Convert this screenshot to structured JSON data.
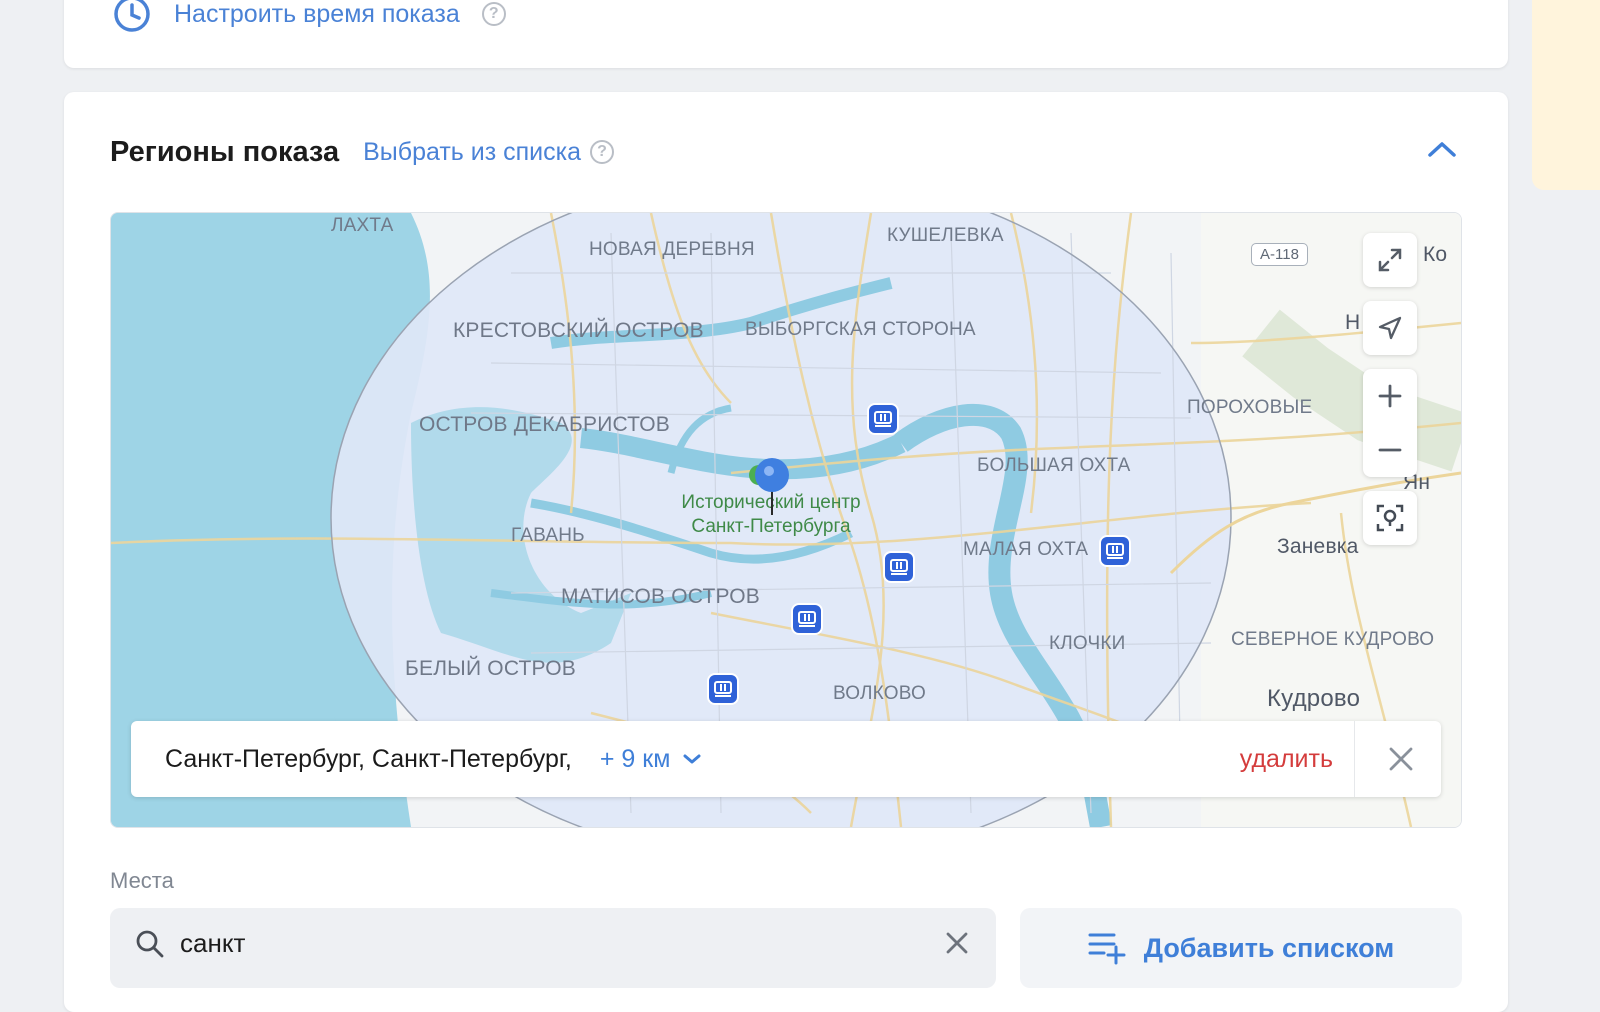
{
  "timing": {
    "label": "Настроить время показа",
    "help": "?"
  },
  "regions": {
    "title": "Регионы показа",
    "select_link": "Выбрать из списка",
    "help": "?"
  },
  "map": {
    "labels": {
      "lakhta": "ЛАХТА",
      "novaya": "НОВАЯ ДЕРЕВНЯ",
      "kushelevka": "КУШЕЛЕВКА",
      "krestovsky": "КРЕСТОВСКИЙ ОСТРОВ",
      "vyborgskaya": "ВЫБОРГСКАЯ СТОРОНА",
      "dekabristov": "ОСТРОВ ДЕКАБРИСТОВ",
      "porokhovye": "ПОРОХОВЫЕ",
      "bolshaya_okhta": "БОЛЬШАЯ ОХТА",
      "gavan": "ГАВАНЬ",
      "malaya_okhta": "МАЛАЯ ОХТА",
      "zanevka": "Заневка",
      "matisov": "МАТИСОВ ОСТРОВ",
      "klochki": "КЛОЧКИ",
      "severnoe_kudrovo": "СЕВЕРНОЕ КУДРОВО",
      "bely": "БЕЛЫЙ ОСТРОВ",
      "volkovo": "ВОЛКОВО",
      "kudrovo": "Кудрово",
      "yan": "Ян",
      "ko": "Ко",
      "no": "Н",
      "road": "А-118",
      "poi_line1": "Исторический центр",
      "poi_line2": "Санкт-Петербурга"
    }
  },
  "region_bar": {
    "name": "Санкт-Петербург, Санкт-Петербург,",
    "radius": "+ 9 км",
    "delete": "удалить"
  },
  "places": {
    "label": "Места",
    "search_value": "санкт",
    "add_list": "Добавить списком"
  }
}
